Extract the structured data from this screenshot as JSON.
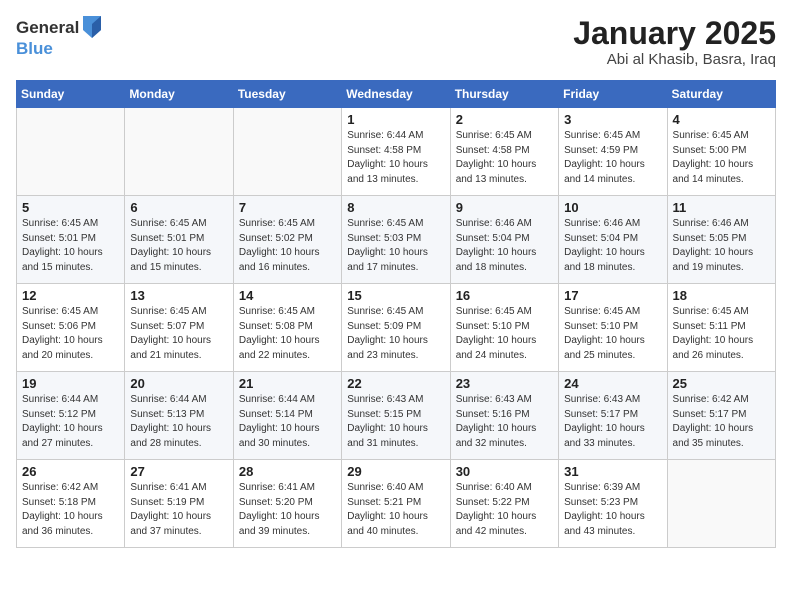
{
  "logo": {
    "general": "General",
    "blue": "Blue"
  },
  "header": {
    "title": "January 2025",
    "subtitle": "Abi al Khasib, Basra, Iraq"
  },
  "weekdays": [
    "Sunday",
    "Monday",
    "Tuesday",
    "Wednesday",
    "Thursday",
    "Friday",
    "Saturday"
  ],
  "weeks": [
    [
      {
        "num": "",
        "info": ""
      },
      {
        "num": "",
        "info": ""
      },
      {
        "num": "",
        "info": ""
      },
      {
        "num": "1",
        "info": "Sunrise: 6:44 AM\nSunset: 4:58 PM\nDaylight: 10 hours\nand 13 minutes."
      },
      {
        "num": "2",
        "info": "Sunrise: 6:45 AM\nSunset: 4:58 PM\nDaylight: 10 hours\nand 13 minutes."
      },
      {
        "num": "3",
        "info": "Sunrise: 6:45 AM\nSunset: 4:59 PM\nDaylight: 10 hours\nand 14 minutes."
      },
      {
        "num": "4",
        "info": "Sunrise: 6:45 AM\nSunset: 5:00 PM\nDaylight: 10 hours\nand 14 minutes."
      }
    ],
    [
      {
        "num": "5",
        "info": "Sunrise: 6:45 AM\nSunset: 5:01 PM\nDaylight: 10 hours\nand 15 minutes."
      },
      {
        "num": "6",
        "info": "Sunrise: 6:45 AM\nSunset: 5:01 PM\nDaylight: 10 hours\nand 15 minutes."
      },
      {
        "num": "7",
        "info": "Sunrise: 6:45 AM\nSunset: 5:02 PM\nDaylight: 10 hours\nand 16 minutes."
      },
      {
        "num": "8",
        "info": "Sunrise: 6:45 AM\nSunset: 5:03 PM\nDaylight: 10 hours\nand 17 minutes."
      },
      {
        "num": "9",
        "info": "Sunrise: 6:46 AM\nSunset: 5:04 PM\nDaylight: 10 hours\nand 18 minutes."
      },
      {
        "num": "10",
        "info": "Sunrise: 6:46 AM\nSunset: 5:04 PM\nDaylight: 10 hours\nand 18 minutes."
      },
      {
        "num": "11",
        "info": "Sunrise: 6:46 AM\nSunset: 5:05 PM\nDaylight: 10 hours\nand 19 minutes."
      }
    ],
    [
      {
        "num": "12",
        "info": "Sunrise: 6:45 AM\nSunset: 5:06 PM\nDaylight: 10 hours\nand 20 minutes."
      },
      {
        "num": "13",
        "info": "Sunrise: 6:45 AM\nSunset: 5:07 PM\nDaylight: 10 hours\nand 21 minutes."
      },
      {
        "num": "14",
        "info": "Sunrise: 6:45 AM\nSunset: 5:08 PM\nDaylight: 10 hours\nand 22 minutes."
      },
      {
        "num": "15",
        "info": "Sunrise: 6:45 AM\nSunset: 5:09 PM\nDaylight: 10 hours\nand 23 minutes."
      },
      {
        "num": "16",
        "info": "Sunrise: 6:45 AM\nSunset: 5:10 PM\nDaylight: 10 hours\nand 24 minutes."
      },
      {
        "num": "17",
        "info": "Sunrise: 6:45 AM\nSunset: 5:10 PM\nDaylight: 10 hours\nand 25 minutes."
      },
      {
        "num": "18",
        "info": "Sunrise: 6:45 AM\nSunset: 5:11 PM\nDaylight: 10 hours\nand 26 minutes."
      }
    ],
    [
      {
        "num": "19",
        "info": "Sunrise: 6:44 AM\nSunset: 5:12 PM\nDaylight: 10 hours\nand 27 minutes."
      },
      {
        "num": "20",
        "info": "Sunrise: 6:44 AM\nSunset: 5:13 PM\nDaylight: 10 hours\nand 28 minutes."
      },
      {
        "num": "21",
        "info": "Sunrise: 6:44 AM\nSunset: 5:14 PM\nDaylight: 10 hours\nand 30 minutes."
      },
      {
        "num": "22",
        "info": "Sunrise: 6:43 AM\nSunset: 5:15 PM\nDaylight: 10 hours\nand 31 minutes."
      },
      {
        "num": "23",
        "info": "Sunrise: 6:43 AM\nSunset: 5:16 PM\nDaylight: 10 hours\nand 32 minutes."
      },
      {
        "num": "24",
        "info": "Sunrise: 6:43 AM\nSunset: 5:17 PM\nDaylight: 10 hours\nand 33 minutes."
      },
      {
        "num": "25",
        "info": "Sunrise: 6:42 AM\nSunset: 5:17 PM\nDaylight: 10 hours\nand 35 minutes."
      }
    ],
    [
      {
        "num": "26",
        "info": "Sunrise: 6:42 AM\nSunset: 5:18 PM\nDaylight: 10 hours\nand 36 minutes."
      },
      {
        "num": "27",
        "info": "Sunrise: 6:41 AM\nSunset: 5:19 PM\nDaylight: 10 hours\nand 37 minutes."
      },
      {
        "num": "28",
        "info": "Sunrise: 6:41 AM\nSunset: 5:20 PM\nDaylight: 10 hours\nand 39 minutes."
      },
      {
        "num": "29",
        "info": "Sunrise: 6:40 AM\nSunset: 5:21 PM\nDaylight: 10 hours\nand 40 minutes."
      },
      {
        "num": "30",
        "info": "Sunrise: 6:40 AM\nSunset: 5:22 PM\nDaylight: 10 hours\nand 42 minutes."
      },
      {
        "num": "31",
        "info": "Sunrise: 6:39 AM\nSunset: 5:23 PM\nDaylight: 10 hours\nand 43 minutes."
      },
      {
        "num": "",
        "info": ""
      }
    ]
  ]
}
